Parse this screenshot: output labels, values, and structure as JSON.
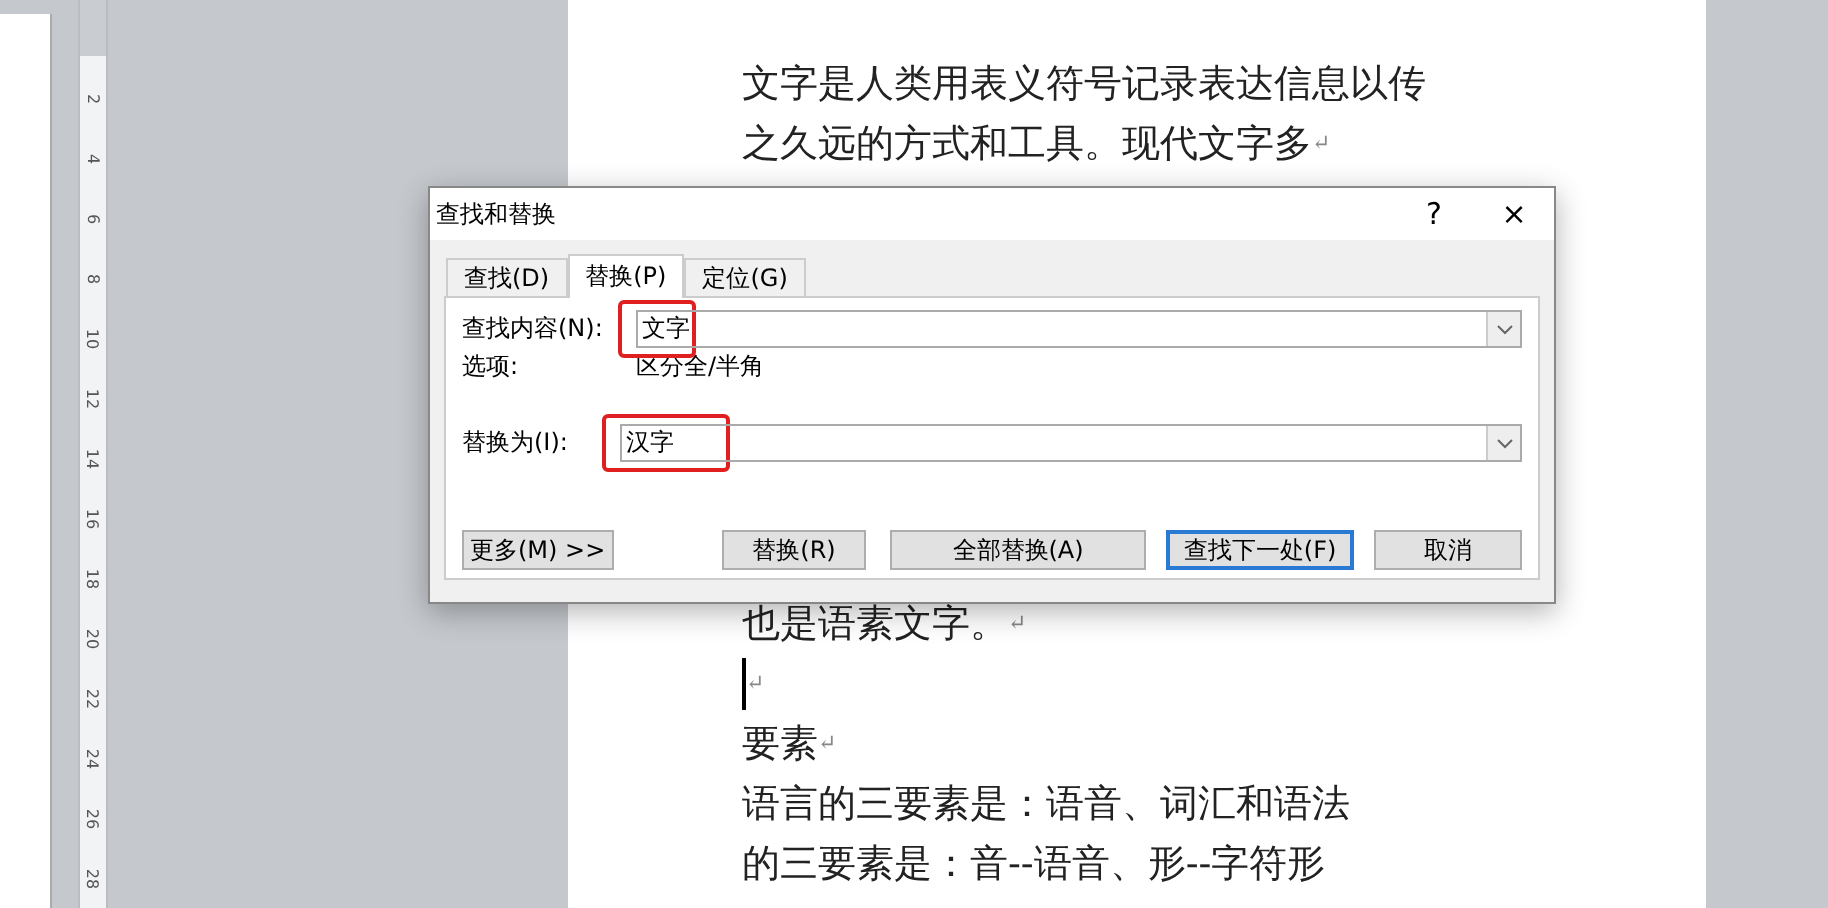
{
  "ruler": {
    "ticks": [
      "2",
      "4",
      "6",
      "8",
      "10",
      "12",
      "14",
      "16",
      "18",
      "20",
      "22",
      "24",
      "26",
      "28"
    ]
  },
  "document": {
    "lines_before": [
      {
        "text": "文字是人类用表义符号记录表达信息以传"
      },
      {
        "text": "之久远的方式和工具。现代文字多",
        "end_mark": "↵"
      }
    ],
    "lines_after": [
      {
        "text": "也是语素文字。",
        "end_mark": "↵"
      },
      {
        "end_mark": "↵",
        "cursor": true
      },
      {
        "text": "要素",
        "end_mark": "↵"
      },
      {
        "text": "语言的三要素是：语音、词汇和语法"
      },
      {
        "text": "的三要素是：音--语音、形--字符形"
      }
    ]
  },
  "dialog": {
    "title": "查找和替换",
    "help": "?",
    "close": "×",
    "tabs": [
      {
        "label": "查找(D)",
        "selected": false
      },
      {
        "label": "替换(P)",
        "selected": true
      },
      {
        "label": "定位(G)",
        "selected": false
      }
    ],
    "find": {
      "label": "查找内容(N):",
      "value": "文字",
      "highlighted": true
    },
    "options": {
      "label": "选项:",
      "value": "区分全/半角"
    },
    "replace": {
      "label": "替换为(I):",
      "value": "汉字",
      "highlighted": true
    },
    "more_button": "更多(M) >>",
    "buttons": [
      {
        "label": "替换(R)",
        "focused": false
      },
      {
        "label": "全部替换(A)",
        "focused": false
      },
      {
        "label": "查找下一处(F)",
        "focused": true
      },
      {
        "label": "取消",
        "focused": false
      }
    ]
  }
}
